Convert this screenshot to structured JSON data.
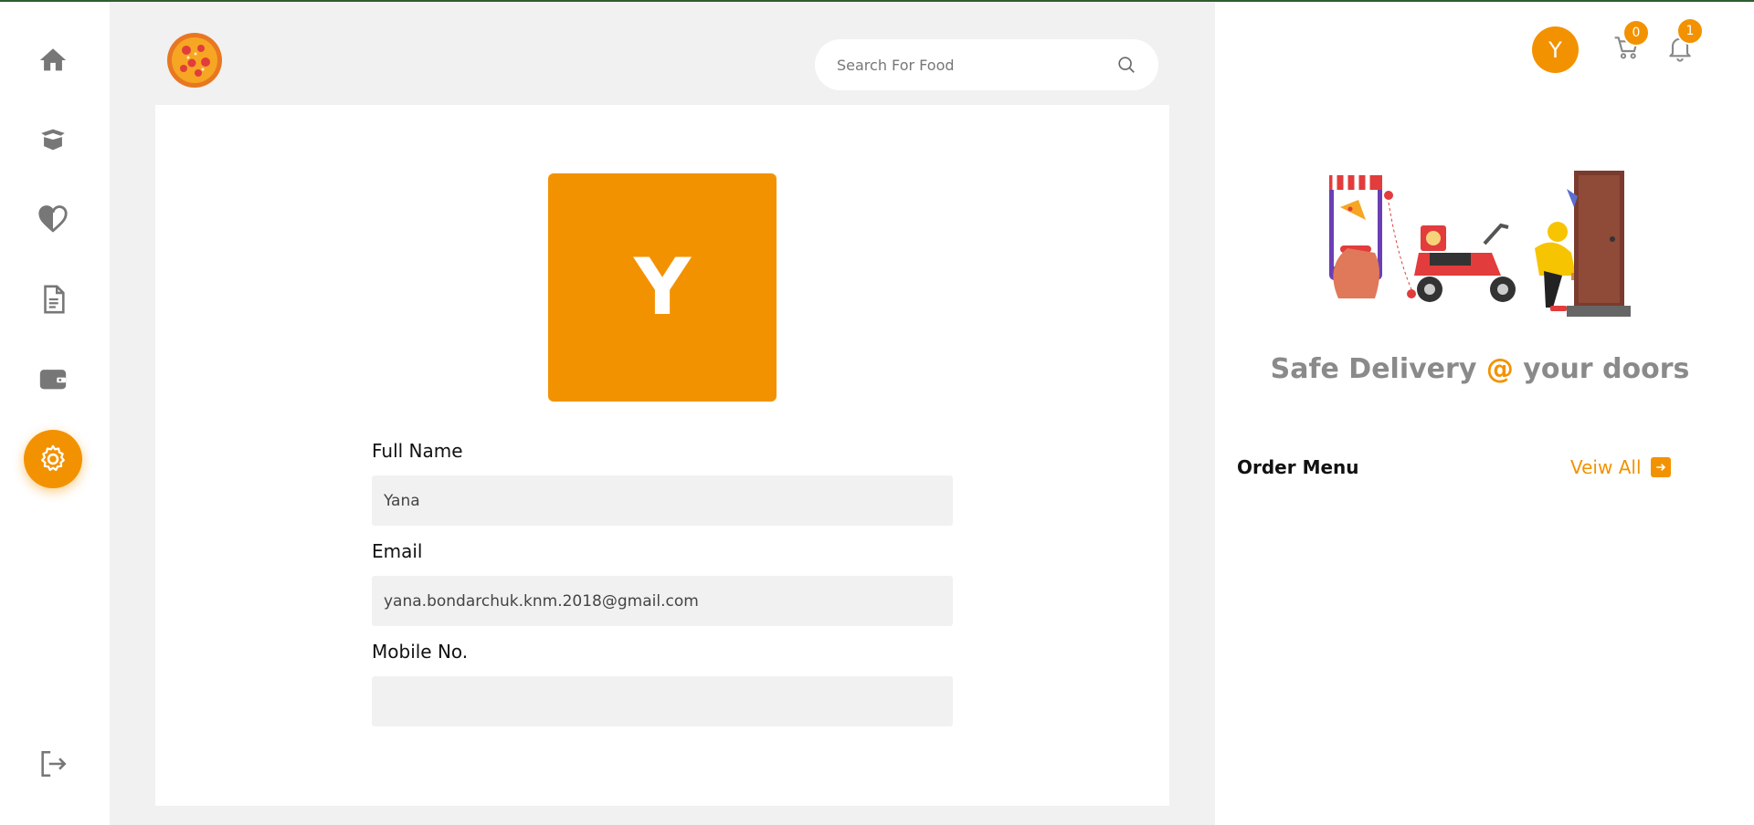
{
  "sidebar": {
    "items": [
      {
        "icon": "home-icon"
      },
      {
        "icon": "box-icon"
      },
      {
        "icon": "heart-icon"
      },
      {
        "icon": "document-icon"
      },
      {
        "icon": "wallet-icon"
      },
      {
        "icon": "gear-icon",
        "active": true
      }
    ],
    "logout_icon": "logout-icon"
  },
  "header": {
    "logo_icon": "pizza-logo-icon",
    "search": {
      "placeholder": "Search For Food",
      "value": ""
    }
  },
  "profile": {
    "avatar_letter": "Y",
    "fields": [
      {
        "label": "Full Name",
        "value": "Yana"
      },
      {
        "label": "Email",
        "value": "yana.bondarchuk.knm.2018@gmail.com"
      },
      {
        "label": "Mobile No.",
        "value": ""
      }
    ]
  },
  "right_panel": {
    "user_avatar_letter": "Y",
    "cart_count": "0",
    "notification_count": "1",
    "promo": {
      "title_part1": "Safe Delivery ",
      "title_at": "@",
      "title_part2": " your doors"
    },
    "order_menu": {
      "title": "Order Menu",
      "view_all": "Veiw All"
    }
  },
  "colors": {
    "accent": "#f39200",
    "background": "#f1f1f1",
    "icon_gray": "#777777"
  }
}
